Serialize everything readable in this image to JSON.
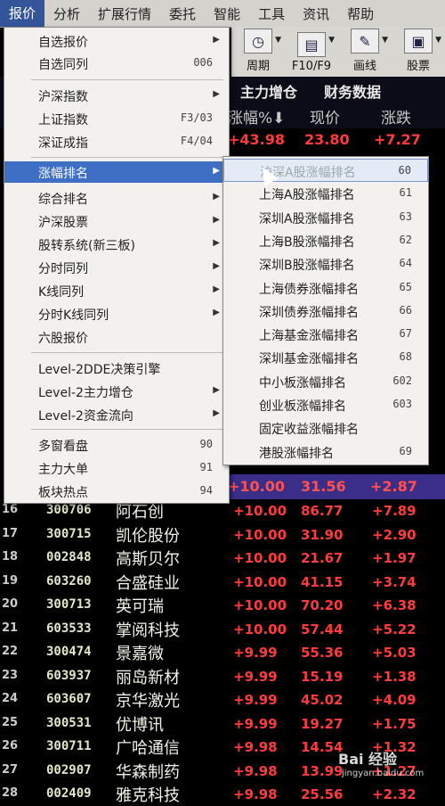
{
  "menubar": [
    "报价",
    "分析",
    "扩展行情",
    "委托",
    "智能",
    "工具",
    "资讯",
    "帮助"
  ],
  "toolbar": [
    {
      "label": "周期",
      "icon": "clock-icon"
    },
    {
      "label": "F10/F9",
      "icon": "document-icon"
    },
    {
      "label": "画线",
      "icon": "pencil-icon"
    },
    {
      "label": "股票",
      "icon": "screen-icon"
    }
  ],
  "table_header": {
    "tab1": "主力增仓",
    "tab2": "财务数据",
    "col_change": "涨幅%",
    "col_price": "现价",
    "col_up": "涨跌"
  },
  "first_row": {
    "change": "+43.98",
    "price": "23.80",
    "up": "+7.27"
  },
  "highlight_row": {
    "change": "+10.00",
    "price": "31.56",
    "up": "+2.87"
  },
  "rows": [
    {
      "n": "16",
      "code": "300706",
      "name": "阿石创",
      "change": "+10.00",
      "price": "86.77",
      "up": "+7.89"
    },
    {
      "n": "17",
      "code": "300715",
      "name": "凯伦股份",
      "change": "+10.00",
      "price": "31.90",
      "up": "+2.90"
    },
    {
      "n": "18",
      "code": "002848",
      "name": "高斯贝尔",
      "change": "+10.00",
      "price": "21.67",
      "up": "+1.97"
    },
    {
      "n": "19",
      "code": "603260",
      "name": "合盛硅业",
      "change": "+10.00",
      "price": "41.15",
      "up": "+3.74"
    },
    {
      "n": "20",
      "code": "300713",
      "name": "英可瑞",
      "change": "+10.00",
      "price": "70.20",
      "up": "+6.38"
    },
    {
      "n": "21",
      "code": "603533",
      "name": "掌阅科技",
      "change": "+10.00",
      "price": "57.44",
      "up": "+5.22"
    },
    {
      "n": "22",
      "code": "300474",
      "name": "景嘉微",
      "change": "+9.99",
      "price": "55.36",
      "up": "+5.03"
    },
    {
      "n": "23",
      "code": "603937",
      "name": "丽岛新材",
      "change": "+9.99",
      "price": "15.19",
      "up": "+1.38"
    },
    {
      "n": "24",
      "code": "603607",
      "name": "京华激光",
      "change": "+9.99",
      "price": "45.02",
      "up": "+4.09"
    },
    {
      "n": "25",
      "code": "300531",
      "name": "优博讯",
      "change": "+9.99",
      "price": "19.27",
      "up": "+1.75"
    },
    {
      "n": "26",
      "code": "300711",
      "name": "广哈通信",
      "change": "+9.98",
      "price": "14.54",
      "up": "+1.32"
    },
    {
      "n": "27",
      "code": "002907",
      "name": "华森制药",
      "change": "+9.98",
      "price": "13.99",
      "up": "+1.27"
    },
    {
      "n": "28",
      "code": "002409",
      "name": "雅克科技",
      "change": "+9.98",
      "price": "25.56",
      "up": "+2.32"
    }
  ],
  "menu": [
    {
      "label": "自选报价",
      "sc": "",
      "arrow": true
    },
    {
      "label": "自选同列",
      "sc": "006",
      "arrow": false
    },
    {
      "label": "沪深指数",
      "sc": "",
      "arrow": true
    },
    {
      "label": "上证指数",
      "sc": "F3/03",
      "arrow": false
    },
    {
      "label": "深证成指",
      "sc": "F4/04",
      "arrow": false
    },
    {
      "label": "涨幅排名",
      "sc": "",
      "arrow": true
    },
    {
      "label": "综合排名",
      "sc": "",
      "arrow": true
    },
    {
      "label": "沪深股票",
      "sc": "",
      "arrow": true
    },
    {
      "label": "股转系统(新三板)",
      "sc": "",
      "arrow": true
    },
    {
      "label": "分时同列",
      "sc": "",
      "arrow": true
    },
    {
      "label": "K线同列",
      "sc": "",
      "arrow": true
    },
    {
      "label": "分时K线同列",
      "sc": "",
      "arrow": true
    },
    {
      "label": "六股报价",
      "sc": "",
      "arrow": false
    },
    {
      "label": "Level-2DDE决策引擎",
      "sc": "",
      "arrow": false
    },
    {
      "label": "Level-2主力增仓",
      "sc": "",
      "arrow": true
    },
    {
      "label": "Level-2资金流向",
      "sc": "",
      "arrow": true
    },
    {
      "label": "多窗看盘",
      "sc": "90",
      "arrow": false
    },
    {
      "label": "主力大单",
      "sc": "91",
      "arrow": false
    },
    {
      "label": "板块热点",
      "sc": "94",
      "arrow": false
    }
  ],
  "submenu": [
    {
      "label": "沪深A股涨幅排名",
      "code": "60"
    },
    {
      "label": "上海A股涨幅排名",
      "code": "61"
    },
    {
      "label": "深圳A股涨幅排名",
      "code": "63"
    },
    {
      "label": "上海B股涨幅排名",
      "code": "62"
    },
    {
      "label": "深圳B股涨幅排名",
      "code": "64"
    },
    {
      "label": "上海债券涨幅排名",
      "code": "65"
    },
    {
      "label": "深圳债券涨幅排名",
      "code": "66"
    },
    {
      "label": "上海基金涨幅排名",
      "code": "67"
    },
    {
      "label": "深圳基金涨幅排名",
      "code": "68"
    },
    {
      "label": "中小板涨幅排名",
      "code": "602"
    },
    {
      "label": "创业板涨幅排名",
      "code": "603"
    },
    {
      "label": "固定收益涨幅排名",
      "code": ""
    },
    {
      "label": "港股涨幅排名",
      "code": "69"
    }
  ],
  "watermark": {
    "text": "Bai 经验",
    "sub": "jingyan.baidu.com"
  },
  "colors": {
    "rise": "#ff3b3b",
    "menu_active": "#3f6fc4",
    "menubar_active": "#35559a"
  }
}
